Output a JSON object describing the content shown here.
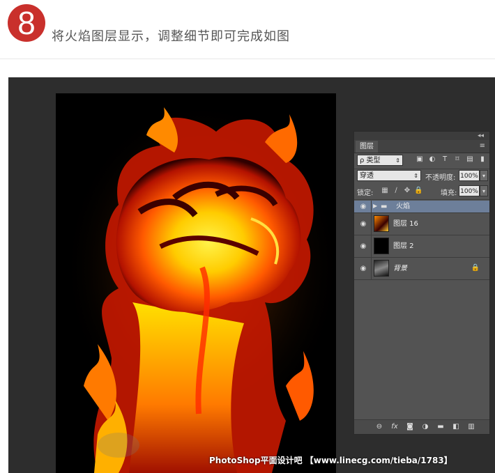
{
  "step": {
    "number": "8",
    "text": "将火焰图层显示，调整细节即可完成如图"
  },
  "watermark": "PhotoShop平面设计吧 【www.linecg.com/tieba/1783】",
  "panel": {
    "collapse_icon": "double-chevron-icon",
    "tab_label": "图层",
    "filter_label": "ρ 类型",
    "blend_mode": "穿透",
    "opacity_label": "不透明度:",
    "opacity_value": "100%",
    "lock_label": "锁定:",
    "fill_label": "填充:",
    "fill_value": "100%",
    "layers": [
      {
        "name": "火焰",
        "type": "group",
        "selected": true
      },
      {
        "name": "图层 16",
        "type": "layer"
      },
      {
        "name": "图层 2",
        "type": "layer"
      },
      {
        "name": "背景",
        "type": "background",
        "locked": true
      }
    ]
  },
  "colors": {
    "accent": "#c9302c",
    "workspace": "#2d2d2d",
    "panel": "#535353",
    "selected_layer": "#6d7f9a"
  }
}
